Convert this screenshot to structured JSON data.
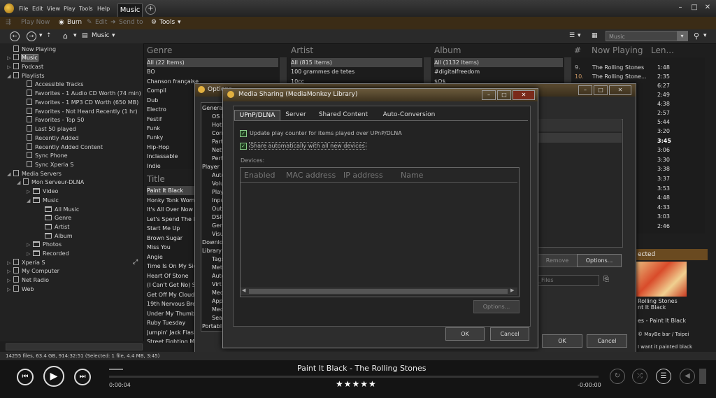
{
  "menu": {
    "items": [
      "File",
      "Edit",
      "View",
      "Play",
      "Tools",
      "Help"
    ],
    "active_tab": "Music"
  },
  "toolbar1": {
    "play_now": "Play Now",
    "burn": "Burn",
    "edit": "Edit",
    "send_to": "Send to",
    "tools": "Tools"
  },
  "toolbar2": {
    "location": "Music",
    "search_placeholder": "Music"
  },
  "tree": {
    "now_playing": "Now Playing",
    "music": "Music",
    "podcast": "Podcast",
    "playlists": "Playlists",
    "playlist_items": [
      "Accessible Tracks",
      "Favorites - 1 Audio CD Worth (74 min)",
      "Favorites - 1 MP3 CD Worth (650 MB)",
      "Favorites - Not Heard Recently (1 hr)",
      "Favorites - Top 50",
      "Last 50 played",
      "Recently Added",
      "Recently Added Content",
      "Sync Phone",
      "Sync Xperia S"
    ],
    "media_servers": "Media Servers",
    "server": "Mon Serveur-DLNA",
    "video": "Video",
    "server_music": "Music",
    "music_children": [
      "All Music",
      "Genre",
      "Artist",
      "Album"
    ],
    "photos": "Photos",
    "recorded": "Recorded",
    "xperia": "Xperia S",
    "my_computer": "My Computer",
    "net_radio": "Net Radio",
    "web": "Web"
  },
  "columns": {
    "genre": "Genre",
    "artist": "Artist",
    "album": "Album",
    "title": "Title",
    "np_num": "#",
    "np_title": "Now Playing",
    "np_len": "Len..."
  },
  "genres": [
    "All (22 Items)",
    "BO",
    "Chanson française",
    "Compil",
    "Dub",
    "Electro",
    "Festif",
    "Funk",
    "Funky",
    "Hip-Hop",
    "Inclassable",
    "Indie"
  ],
  "artists": [
    "All (815 Items)",
    "100 grammes de tetes",
    "10cc"
  ],
  "albums": [
    "All (1132 Items)",
    "#digitalfreedom",
    "$O$"
  ],
  "titles": [
    "Paint It Black",
    "Honky Tonk Wome",
    "It's All Over Now",
    "Let's Spend The N",
    "Start Me Up",
    "Brown Sugar",
    "Miss You",
    "Angie",
    "Time Is On My Sid",
    "Heart Of Stone",
    "(I Can't Get No) S",
    "Get Off My Cloud",
    "19th Nervous Brea",
    "Under My Thumb",
    "Ruby Tuesday",
    "Jumpin' Jack Flash",
    "Street Fighting M"
  ],
  "now_playing": {
    "rows": [
      {
        "num": "9.",
        "title": "The Rolling Stones",
        "len": "1:48"
      },
      {
        "num": "10.",
        "title": "The Rolling Stone...",
        "len": "2:35"
      }
    ],
    "lengths": [
      "6:27",
      "2:49",
      "4:38",
      "2:57",
      "5:44",
      "3:20",
      "3:45",
      "3:06",
      "3:30",
      "3:38",
      "3:37",
      "3:53",
      "4:48",
      "4:33",
      "3:03",
      "2:46"
    ]
  },
  "options_dialog": {
    "title": "Options",
    "nav": [
      "General",
      "OS I",
      "Hotk",
      "Conf",
      "Part",
      "Netw",
      "Perf",
      "Player",
      "Auto",
      "Volu",
      "Play",
      "Inpu",
      "Outp",
      "DSP",
      "Gen",
      "Visu",
      "Downloa",
      "Library",
      "Tags",
      "Meta",
      "Auto",
      "Virt",
      "Medi",
      "App",
      "Medi",
      "Sear",
      "Portabl"
    ],
    "remove": "Remove",
    "options": "Options...",
    "files": "_Files",
    "ok": "OK",
    "cancel": "Cancel",
    "selected": "ected"
  },
  "media_sharing": {
    "title": "Media Sharing (MediaMonkey Library)",
    "tabs": [
      "UPnP/DLNA",
      "Server",
      "Shared Content",
      "Auto-Conversion"
    ],
    "check1": "Update play counter for items played over UPnP/DLNA",
    "check2": "Share automatically with all new devices",
    "devices_label": "Devices:",
    "device_cols": [
      "Enabled",
      "MAC address",
      "IP address",
      "Name"
    ],
    "options": "Options...",
    "ok": "OK",
    "cancel": "Cancel"
  },
  "art_panel": {
    "line1": "Rolling Stones",
    "line2": "nt It Black",
    "line3": "es - Paint It Black",
    "line4": "© MayBe bar / Taipei",
    "line5": "I want it painted black"
  },
  "status": "14255 files, 63.4 GB, 914:32:51 (Selected: 1 file, 4.4 MB, 3:45)",
  "player": {
    "track": "Paint It Black - The Rolling Stones",
    "elapsed": "0:00:04",
    "remaining": "-0:00:00",
    "rating": "★★★★★",
    "rating_value": 5,
    "progress": 0.0
  }
}
